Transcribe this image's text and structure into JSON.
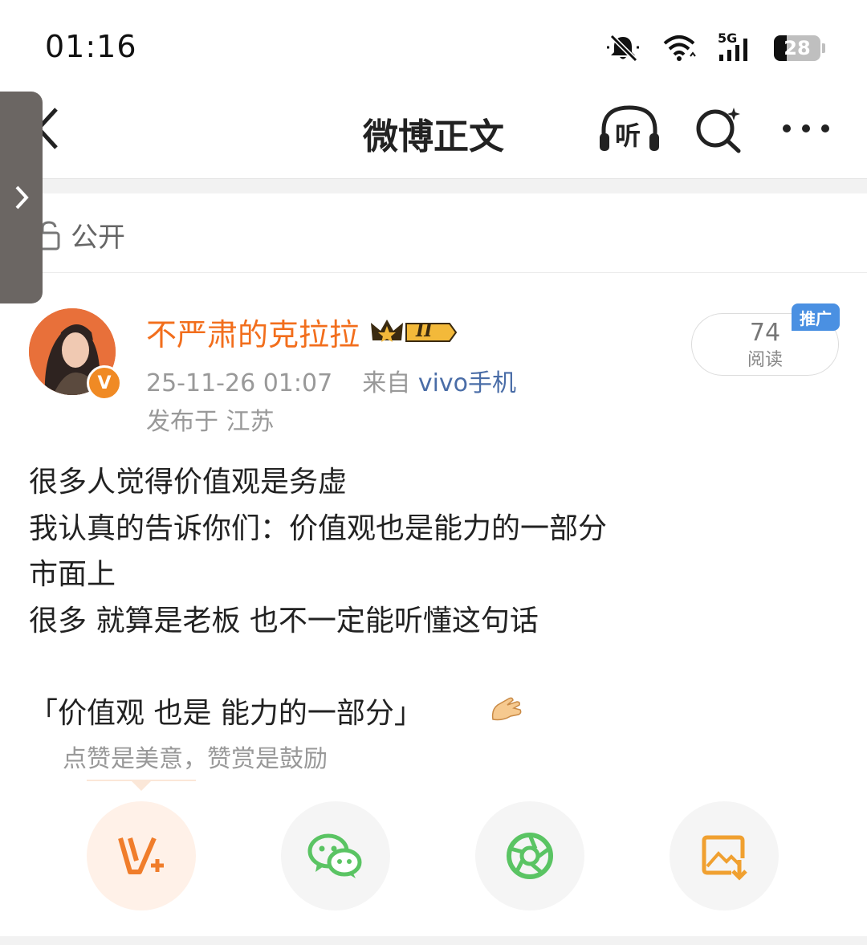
{
  "status_bar": {
    "time": "01:16",
    "network": "5G",
    "battery": "28"
  },
  "nav": {
    "title": "微博正文",
    "listen_label": "听"
  },
  "post": {
    "visibility": "公开",
    "author": {
      "name": "不严肃的克拉拉",
      "vip_level": "II",
      "verify_mark": "V"
    },
    "timestamp": "25-11-26 01:07",
    "source_prefix": "来自",
    "source": "vivo手机",
    "location": "发布于 江苏",
    "reads": {
      "count": "74",
      "label": "阅读",
      "promo_badge": "推广"
    },
    "lines": [
      "很多人觉得价值观是务虚",
      "我认真的告诉你们：价值观也是能力的一部分",
      "市面上",
      "很多 就算是老板 也不一定能听懂这句话",
      "「价值观 也是 能力的一部分」"
    ],
    "emoji": "🫰"
  },
  "reward": {
    "tip": "点赞是美意，赞赏是鼓励",
    "actions": [
      {
        "icon": "reward-v-plus-icon",
        "color": "#f07d2b"
      },
      {
        "icon": "wechat-icon",
        "color": "#5ac463"
      },
      {
        "icon": "moments-icon",
        "color": "#5ac463"
      },
      {
        "icon": "save-image-icon",
        "color": "#f0a030"
      }
    ]
  }
}
